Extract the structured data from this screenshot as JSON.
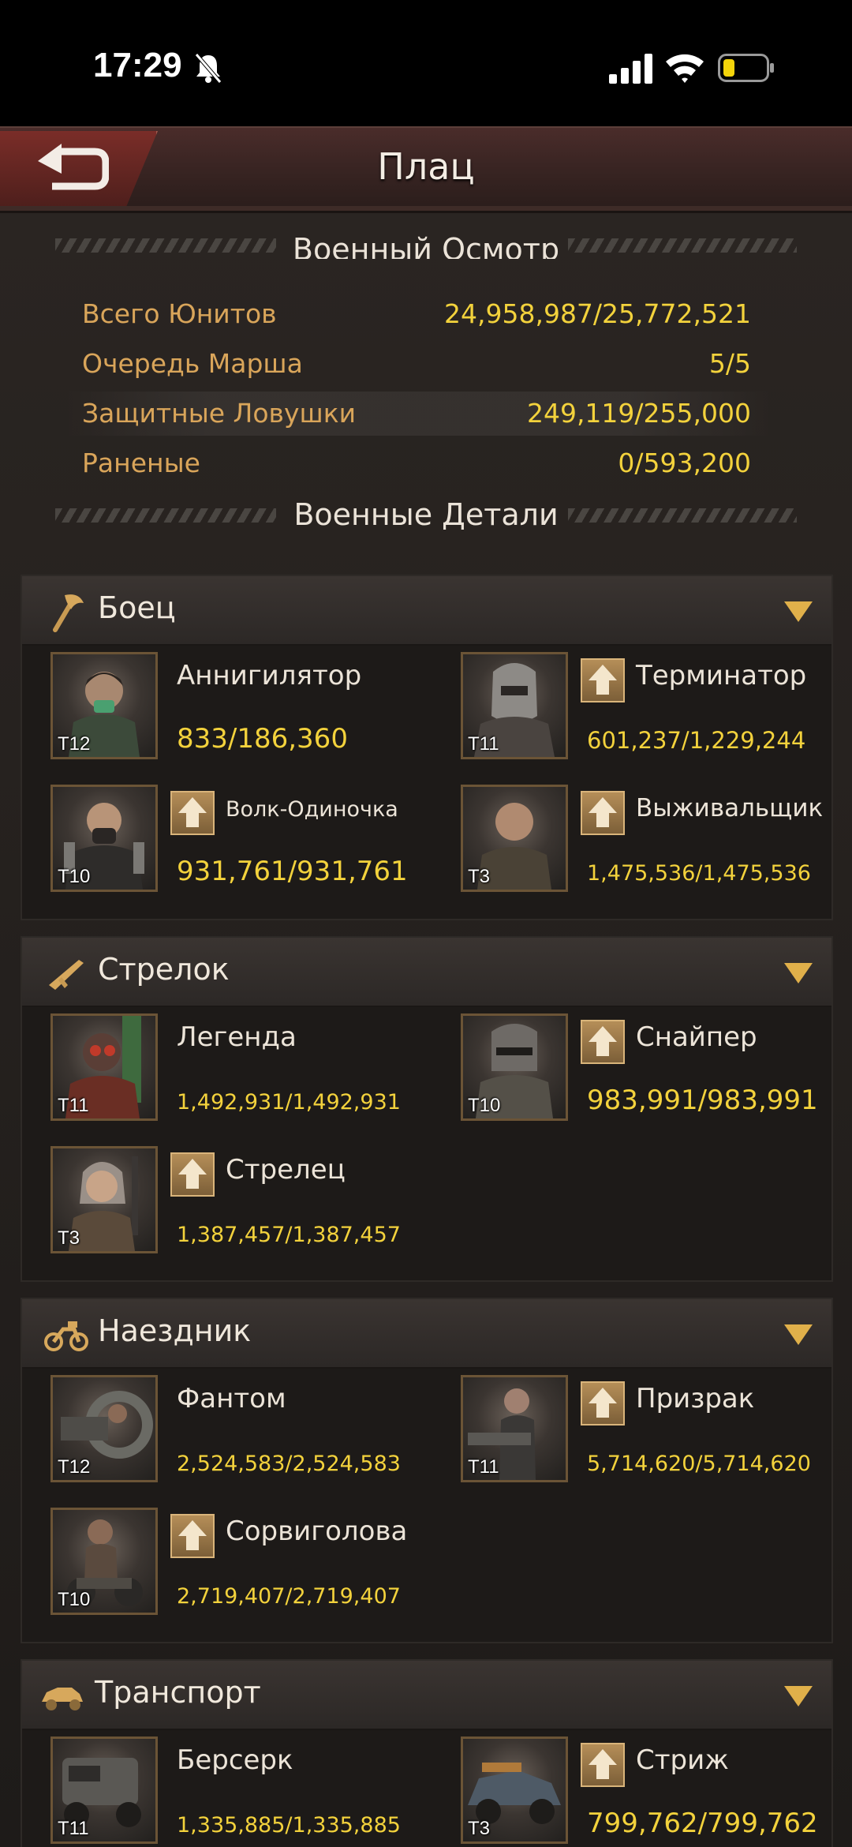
{
  "status_bar": {
    "time": "17:29"
  },
  "header": {
    "title": "Плац"
  },
  "inspection": {
    "title": "Военный Осмотр",
    "rows": [
      {
        "label": "Всего Юнитов",
        "value": "24,958,987/25,772,521"
      },
      {
        "label": "Очередь Марша",
        "value": "5/5"
      },
      {
        "label": "Защитные Ловушки",
        "value": "249,119/255,000"
      },
      {
        "label": "Раненые",
        "value": "0/593,200"
      }
    ]
  },
  "details_title": "Военные Детали",
  "categories": [
    {
      "title": "Боец",
      "icon": "axe-icon",
      "units": [
        {
          "name": "Аннигилятор",
          "tier": "T12",
          "count": "833/186,360",
          "upgrade": false
        },
        {
          "name": "Терминатор",
          "tier": "T11",
          "count": "601,237/1,229,244",
          "upgrade": true
        },
        {
          "name": "Волк-Одиночка",
          "tier": "T10",
          "count": "931,761/931,761",
          "upgrade": true
        },
        {
          "name": "Выживальщик",
          "tier": "T3",
          "count": "1,475,536/1,475,536",
          "upgrade": true
        }
      ]
    },
    {
      "title": "Стрелок",
      "icon": "rifle-icon",
      "units": [
        {
          "name": "Легенда",
          "tier": "T11",
          "count": "1,492,931/1,492,931",
          "upgrade": false
        },
        {
          "name": "Снайпер",
          "tier": "T10",
          "count": "983,991/983,991",
          "upgrade": true
        },
        {
          "name": "Стрелец",
          "tier": "T3",
          "count": "1,387,457/1,387,457",
          "upgrade": true
        }
      ]
    },
    {
      "title": "Наездник",
      "icon": "motorcycle-icon",
      "units": [
        {
          "name": "Фантом",
          "tier": "T12",
          "count": "2,524,583/2,524,583",
          "upgrade": false
        },
        {
          "name": "Призрак",
          "tier": "T11",
          "count": "5,714,620/5,714,620",
          "upgrade": true
        },
        {
          "name": "Сорвиголова",
          "tier": "T10",
          "count": "2,719,407/2,719,407",
          "upgrade": true
        }
      ]
    },
    {
      "title": "Транспорт",
      "icon": "car-icon",
      "units": [
        {
          "name": "Берсерк",
          "tier": "T11",
          "count": "1,335,885/1,335,885",
          "upgrade": false
        },
        {
          "name": "Стриж",
          "tier": "T3",
          "count": "799,762/799,762",
          "upgrade": true
        }
      ]
    }
  ],
  "colors": {
    "accent_gold": "#f3d23c",
    "label_orange": "#d9a55a",
    "header_red": "#4a2c2a"
  }
}
